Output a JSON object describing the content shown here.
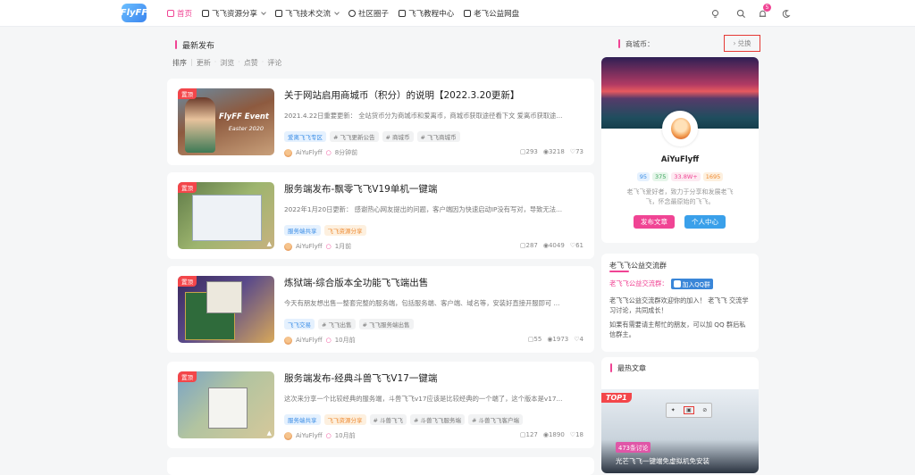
{
  "header": {
    "logo_text": "FlyFF",
    "nav": [
      {
        "label": "首页",
        "icon": "home-icon"
      },
      {
        "label": "飞飞资源分享",
        "icon": "share-icon"
      },
      {
        "label": "飞飞技术交流",
        "icon": "wrench-icon"
      },
      {
        "label": "社区圈子",
        "icon": "chat-icon"
      },
      {
        "label": "飞飞教程中心",
        "icon": "monitor-icon"
      },
      {
        "label": "老飞公益网盘",
        "icon": "file-icon"
      }
    ],
    "notification_count": "5",
    "icons": [
      "bulb-icon",
      "search-icon",
      "bell-icon",
      "moon-icon"
    ]
  },
  "main": {
    "section_title": "最新发布",
    "sort": [
      "排序",
      "更新",
      "浏览",
      "点赞",
      "评论"
    ],
    "posts": [
      {
        "badge": "置顶",
        "title": "关于网站启用商城币（积分）的说明【2022.3.20更新】",
        "excerpt": "2021.4.22日重要更新： 全站货币分为商城币和爱离币，商城币获取途径看下文 爱离币获取途...",
        "tags": [
          "爱离飞飞专区",
          "# 飞飞更新公告",
          "# 商城币",
          "# 飞飞商城币"
        ],
        "author": "AiYuFlyff",
        "time": "8分钟前",
        "comments": "293",
        "views": "3218",
        "likes": "73",
        "thumb_text": "FlyFF Event",
        "thumb_sub": "Easter 2020"
      },
      {
        "badge": "置顶",
        "title": "服务端发布-飘零飞飞V19单机一键端",
        "excerpt": "2022年1月20日更新： 感谢热心网友提出的问题，客户端因为快速启动IP没有写对，导致无法...",
        "tags": [
          "服务端共享",
          "飞飞资源分享"
        ],
        "author": "AiYuFlyff",
        "time": "1月前",
        "comments": "287",
        "views": "4049",
        "likes": "61"
      },
      {
        "badge": "置顶",
        "title": "炼狱端-综合版本全功能飞飞端出售",
        "excerpt": "今天有朋友想出售一整套完整的服务端，包括服务端、客户端、域名等，安装好直接开服即可 ...",
        "tags": [
          "飞飞交易",
          "# 飞飞出售",
          "# 飞飞服务端出售"
        ],
        "author": "AiYuFlyff",
        "time": "10月前",
        "comments": "55",
        "views": "1973",
        "likes": "4"
      },
      {
        "badge": "置顶",
        "title": "服务端发布-经典斗兽飞飞V17一键端",
        "excerpt": "这次来分享一个比较经典的服务端，斗兽飞飞v17应该是比较经典的一个端了，这个版本是v17...",
        "tags": [
          "服务端共享",
          "飞飞资源分享",
          "# 斗兽飞飞",
          "# 斗兽飞飞服务端",
          "# 斗兽飞飞客户端"
        ],
        "author": "AiYuFlyff",
        "time": "10月前",
        "comments": "127",
        "views": "1890",
        "likes": "18"
      }
    ]
  },
  "sidebar": {
    "profile": {
      "coin_label": "商城币：",
      "redeem": "兑换",
      "name": "AiYuFlyff",
      "stats": [
        "95",
        "375",
        "33.8W+",
        "1695"
      ],
      "bio": "老飞飞爱好者，致力于分享和发展老飞飞，怀念最原始的飞飞。",
      "publish": "发布文章",
      "center": "个人中心"
    },
    "group": {
      "title": "老飞飞公益交流群",
      "label": "老飞飞公益交流群：",
      "join": "加入QQ群",
      "text1": "老飞飞公益交流群欢迎你的加入！ 老飞飞 交流学习讨论，共同成长！",
      "text2": "如果有需要请主帮忙的朋友，可以加 QQ 群后私信群主。"
    },
    "hot": {
      "title": "最热文章",
      "rank": "TOP1",
      "comments": "473条讨论",
      "post_title": "光芒飞飞一键端免虚拟机免安装"
    }
  }
}
